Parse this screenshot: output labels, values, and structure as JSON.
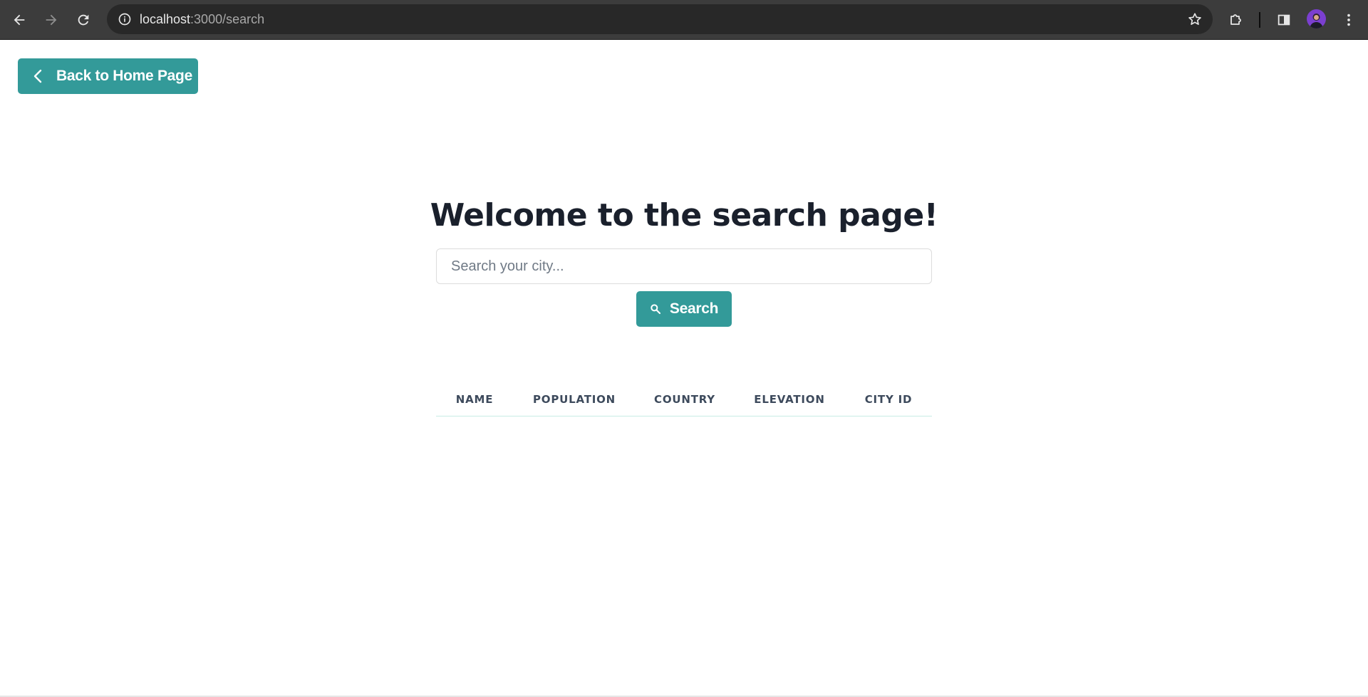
{
  "browser": {
    "url_host": "localhost",
    "url_path": ":3000/search",
    "icons": {
      "back": "arrow-left-icon",
      "forward": "arrow-right-icon",
      "reload": "reload-icon",
      "site_info": "info-icon",
      "bookmark": "star-icon",
      "extensions": "puzzle-icon",
      "side_panel": "side-panel-icon",
      "menu": "kebab-menu-icon"
    }
  },
  "page": {
    "back_button_label": "Back to Home Page",
    "title": "Welcome to the search page!",
    "search": {
      "placeholder": "Search your city...",
      "value": "",
      "button_label": "Search"
    },
    "table": {
      "columns": [
        "NAME",
        "POPULATION",
        "COUNTRY",
        "ELEVATION",
        "CITY ID"
      ],
      "rows": []
    }
  },
  "colors": {
    "accent": "#339a99",
    "title": "#1a202c",
    "table_header": "#3d4a5c",
    "table_divider": "#c8ece5"
  }
}
